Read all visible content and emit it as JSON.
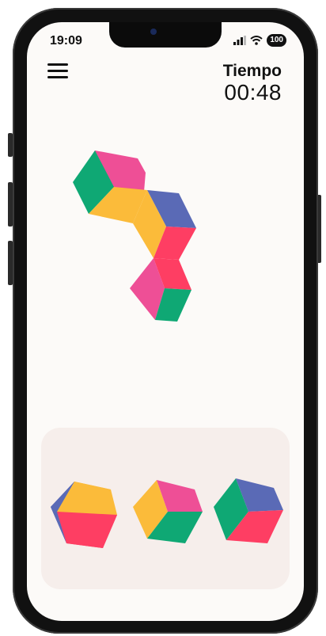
{
  "status_bar": {
    "time": "19:09",
    "battery": "100"
  },
  "header": {
    "menu_icon": "hamburger-menu-icon",
    "timer_label": "Tiempo",
    "timer_value": "00:48"
  },
  "colors": {
    "green": "#0fa874",
    "pink": "#ee4f96",
    "yellow": "#fbbb3a",
    "blue": "#5a6ab6",
    "red": "#fe3e63",
    "background": "#fcfaf8",
    "tray": "#f6eeeb"
  },
  "puzzle": {
    "target_shape": "isometric-cube-cluster",
    "cube_count": 4
  },
  "tray": {
    "pieces": [
      {
        "id": "piece-1",
        "top": "yellow",
        "left": "blue",
        "right": "red"
      },
      {
        "id": "piece-2",
        "top": "pink",
        "left": "yellow",
        "right": "green"
      },
      {
        "id": "piece-3",
        "top": "blue",
        "left": "green",
        "right": "red"
      }
    ]
  }
}
